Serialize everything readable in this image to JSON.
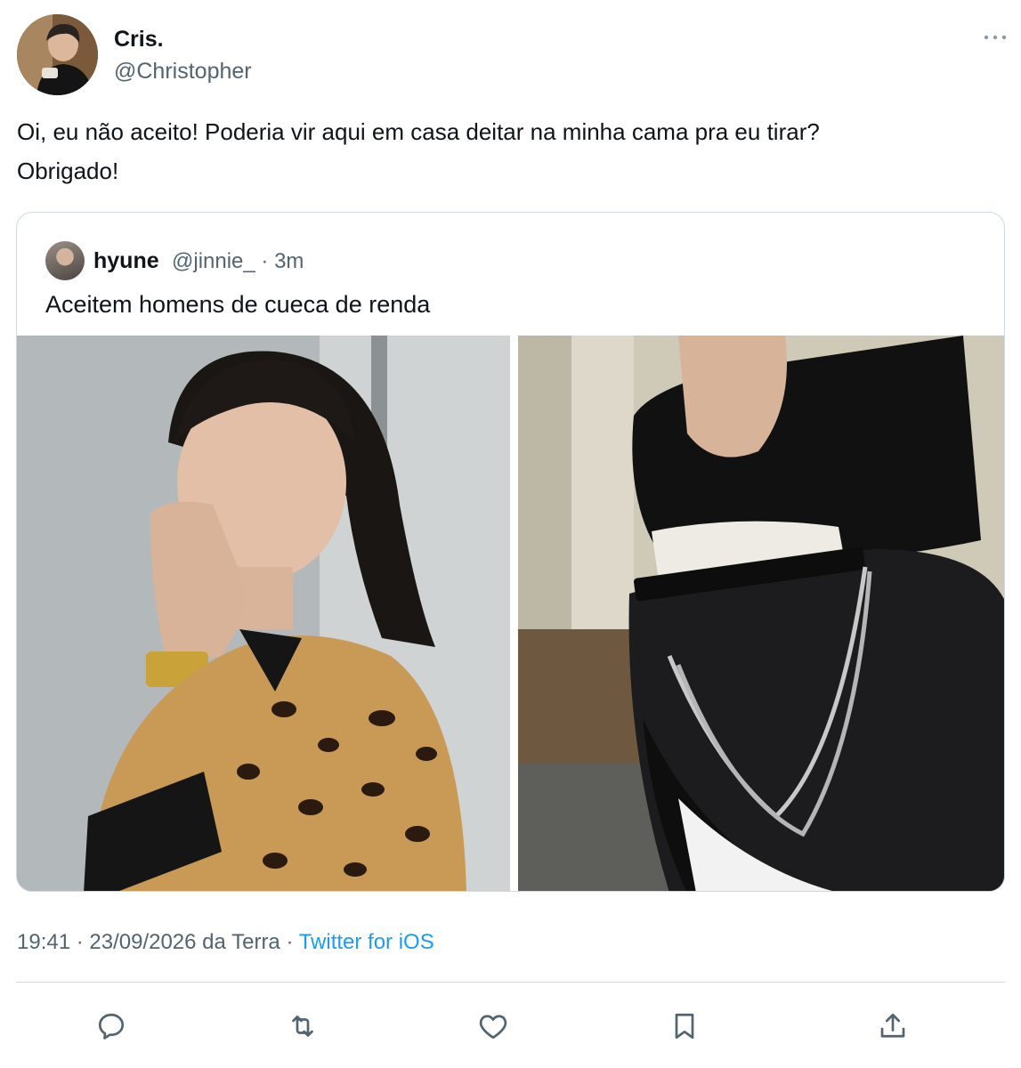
{
  "author": {
    "display_name": "Cris.",
    "handle": "@Christopher"
  },
  "more_icon": "more-horizontal-icon",
  "tweet_text_line1": "Oi, eu não aceito! Poderia vir aqui em casa deitar na minha cama pra eu tirar?",
  "tweet_text_line2": "Obrigado!",
  "quote": {
    "display_name": "hyune",
    "meta": "@jinnie_ · 3m",
    "text": "Aceitem homens de cueca de renda"
  },
  "meta": {
    "timestamp": "19:41 · 23/09/2026 da Terra · ",
    "source": "Twitter for iOS"
  },
  "actions": {
    "reply_icon": "reply-icon",
    "retweet_icon": "retweet-icon",
    "like_icon": "like-icon",
    "bookmark_icon": "bookmark-icon",
    "share_icon": "share-icon"
  },
  "colors": {
    "text": "#0f1419",
    "secondary": "#536471",
    "link": "#1d9bf0",
    "border": "#cfd9de"
  }
}
